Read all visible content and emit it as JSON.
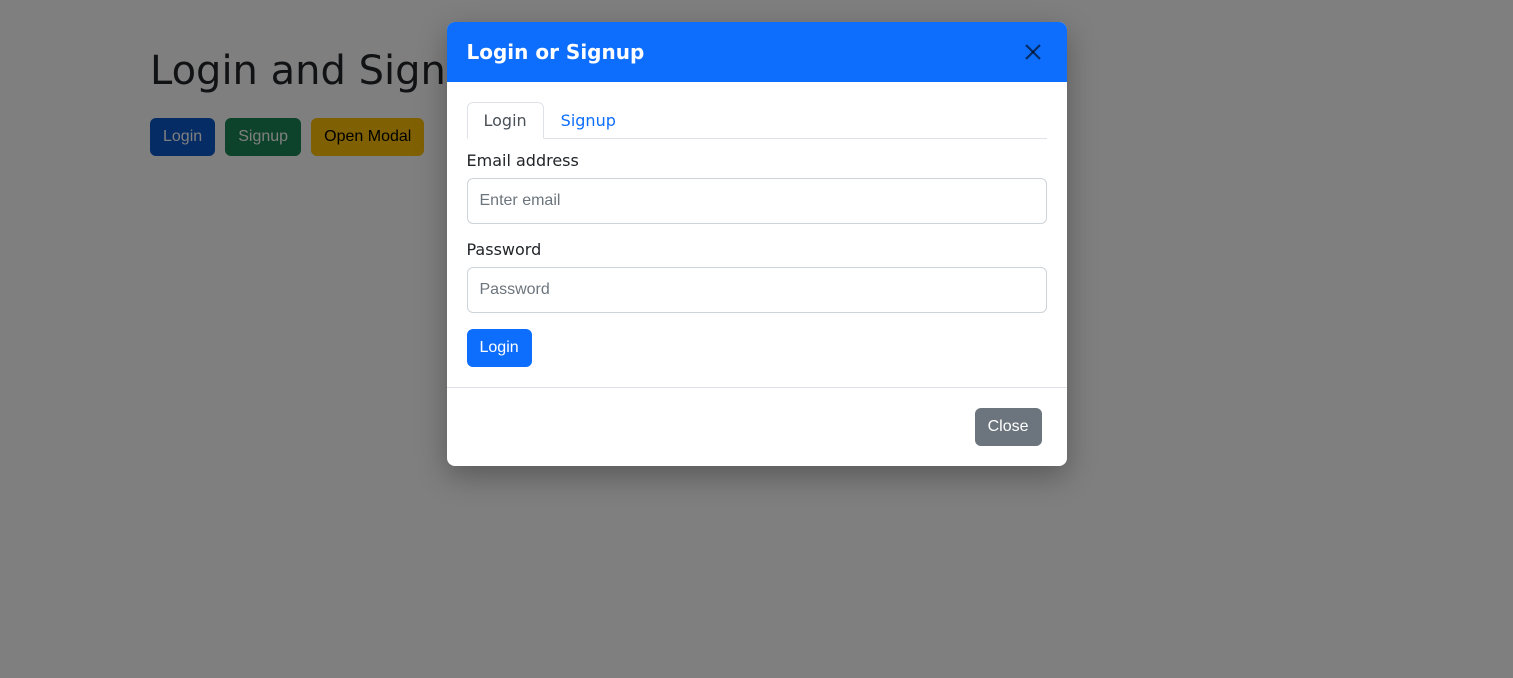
{
  "page": {
    "heading": "Login and Signup Modal"
  },
  "buttons": {
    "login": "Login",
    "signup": "Signup",
    "openModal": "Open Modal"
  },
  "modal": {
    "title": "Login or Signup",
    "tabs": {
      "login": "Login",
      "signup": "Signup"
    },
    "form": {
      "emailLabel": "Email address",
      "emailPlaceholder": "Enter email",
      "emailValue": "",
      "passwordLabel": "Password",
      "passwordPlaceholder": "Password",
      "passwordValue": "",
      "submitLabel": "Login"
    },
    "footer": {
      "closeLabel": "Close"
    }
  }
}
